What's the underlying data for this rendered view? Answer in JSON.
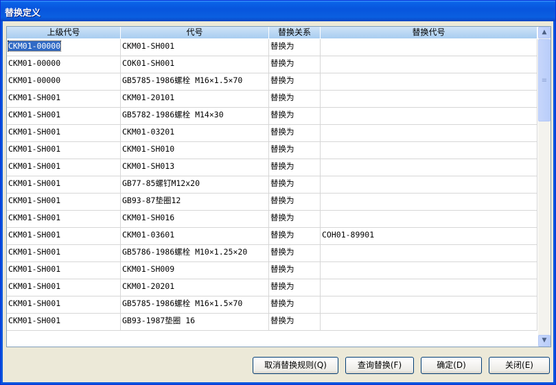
{
  "window": {
    "title": "替换定义"
  },
  "table": {
    "columns": [
      "上级代号",
      "代号",
      "替换关系",
      "替换代号"
    ],
    "rows": [
      [
        "CKM01-00000",
        "CKM01-SH001",
        "替换为",
        ""
      ],
      [
        "CKM01-00000",
        "COK01-SH001",
        "替换为",
        ""
      ],
      [
        "CKM01-00000",
        "GB5785-1986螺栓 M16×1.5×70",
        "替换为",
        ""
      ],
      [
        "CKM01-SH001",
        "CKM01-20101",
        "替换为",
        ""
      ],
      [
        "CKM01-SH001",
        "GB5782-1986螺栓 M14×30",
        "替换为",
        ""
      ],
      [
        "CKM01-SH001",
        "CKM01-03201",
        "替换为",
        ""
      ],
      [
        "CKM01-SH001",
        "CKM01-SH010",
        "替换为",
        ""
      ],
      [
        "CKM01-SH001",
        "CKM01-SH013",
        "替换为",
        ""
      ],
      [
        "CKM01-SH001",
        "GB77-85螺钉M12x20",
        "替换为",
        ""
      ],
      [
        "CKM01-SH001",
        "GB93-87垫圈12",
        "替换为",
        ""
      ],
      [
        "CKM01-SH001",
        "CKM01-SH016",
        "替换为",
        ""
      ],
      [
        "CKM01-SH001",
        "CKM01-03601",
        "替换为",
        "COH01-89901"
      ],
      [
        "CKM01-SH001",
        "GB5786-1986螺栓 M10×1.25×20",
        "替换为",
        ""
      ],
      [
        "CKM01-SH001",
        "CKM01-SH009",
        "替换为",
        ""
      ],
      [
        "CKM01-SH001",
        "CKM01-20201",
        "替换为",
        ""
      ],
      [
        "CKM01-SH001",
        "GB5785-1986螺栓 M16×1.5×70",
        "替换为",
        ""
      ],
      [
        "CKM01-SH001",
        "GB93-1987垫圈 16",
        "替换为",
        ""
      ]
    ],
    "selected_row": 0
  },
  "buttons": {
    "cancel_rule": "取消替换规则(Q)",
    "query": "查询替换(F)",
    "ok": "确定(D)",
    "close": "关闭(E)"
  },
  "icons": {
    "scroll_up": "scroll-up-arrow-icon",
    "scroll_down": "scroll-down-arrow-icon",
    "thumb_grip": "scroll-thumb-grip-icon"
  },
  "colors": {
    "title_bar": "#0855dd",
    "selection": "#316ac5",
    "header": "#a8cdf0",
    "dialog_bg": "#ece9d8"
  }
}
